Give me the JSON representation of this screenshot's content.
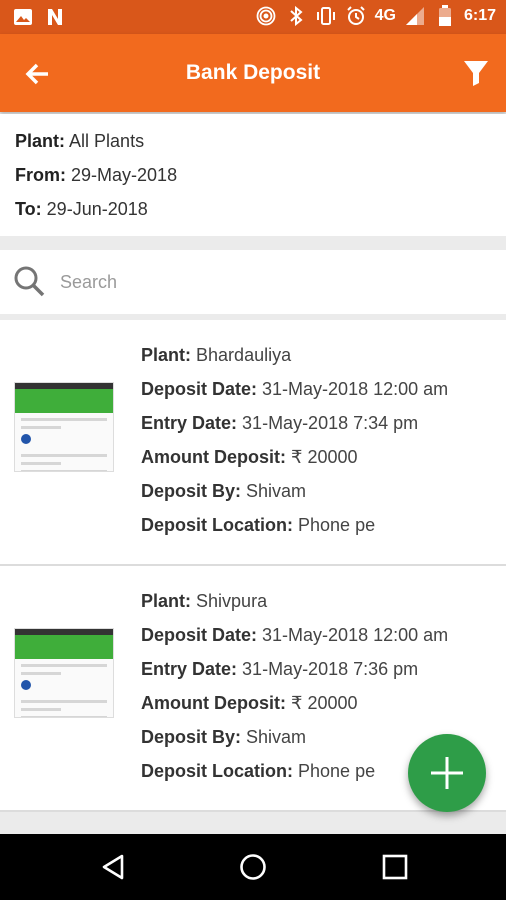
{
  "status_bar": {
    "network": "4G",
    "time": "6:17"
  },
  "app_bar": {
    "title": "Bank Deposit"
  },
  "filters": {
    "plant_label": "Plant:",
    "plant_value": "All Plants",
    "from_label": "From:",
    "from_value": "29-May-2018",
    "to_label": "To:",
    "to_value": "29-Jun-2018"
  },
  "search": {
    "placeholder": "Search"
  },
  "labels": {
    "plant": "Plant:",
    "deposit_date": "Deposit Date:",
    "entry_date": "Entry Date:",
    "amount": "Amount Deposit:",
    "deposit_by": "Deposit By:",
    "location": "Deposit Location:"
  },
  "deposits": [
    {
      "plant": "Bhardauliya",
      "deposit_date": "31-May-2018 12:00 am",
      "entry_date": "31-May-2018 7:34 pm",
      "amount": "₹ 20000",
      "deposit_by": "Shivam",
      "location": "Phone pe"
    },
    {
      "plant": "Shivpura",
      "deposit_date": "31-May-2018 12:00 am",
      "entry_date": "31-May-2018 7:36 pm",
      "amount": "₹ 20000",
      "deposit_by": "Shivam",
      "location": "Phone pe"
    }
  ],
  "colors": {
    "status_bar": "#d9571a",
    "app_bar": "#f26a1e",
    "fab": "#2e9d48"
  }
}
